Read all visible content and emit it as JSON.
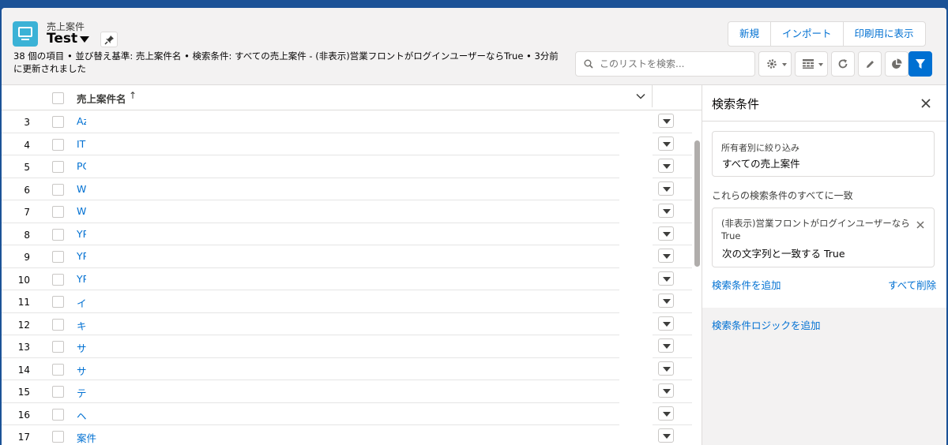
{
  "header": {
    "object_label": "売上案件",
    "list_title": "Test",
    "meta_line": "38 個の項目 • 並び替え基準: 売上案件名 • 検索条件: すべての売上案件 - (非表示)営業フロントがログインユーザーならTrue • 3分前 に更新されました",
    "buttons": {
      "new": "新規",
      "import": "インポート",
      "print": "印刷用に表示"
    },
    "search_placeholder": "このリストを検索..."
  },
  "grid": {
    "column_name": "売上案件名",
    "sort_indicator": "↑",
    "rows": [
      {
        "num": "3",
        "name": "Az"
      },
      {
        "num": "4",
        "name": "IT"
      },
      {
        "num": "5",
        "name": "PC"
      },
      {
        "num": "6",
        "name": "W"
      },
      {
        "num": "7",
        "name": "W"
      },
      {
        "num": "8",
        "name": "YP"
      },
      {
        "num": "9",
        "name": "YP"
      },
      {
        "num": "10",
        "name": "YP"
      },
      {
        "num": "11",
        "name": "イ"
      },
      {
        "num": "12",
        "name": "キ"
      },
      {
        "num": "13",
        "name": "サ"
      },
      {
        "num": "14",
        "name": "サ"
      },
      {
        "num": "15",
        "name": "テ"
      },
      {
        "num": "16",
        "name": "ヘ"
      },
      {
        "num": "17",
        "name": "案件"
      }
    ]
  },
  "filter_panel": {
    "title": "検索条件",
    "owner_label": "所有者別に絞り込み",
    "owner_value": "すべての売上案件",
    "match_label": "これらの検索条件のすべてに一致",
    "filter_name": "(非表示)営業フロントがログインユーザーなら True",
    "filter_operator": "次の文字列と一致する  True",
    "add_filter": "検索条件を追加",
    "remove_all": "すべて削除",
    "add_logic": "検索条件ロジックを追加"
  },
  "colors": {
    "brand": "#1b5297",
    "link": "#0070d2",
    "object_icon": "#3bb2d6"
  }
}
